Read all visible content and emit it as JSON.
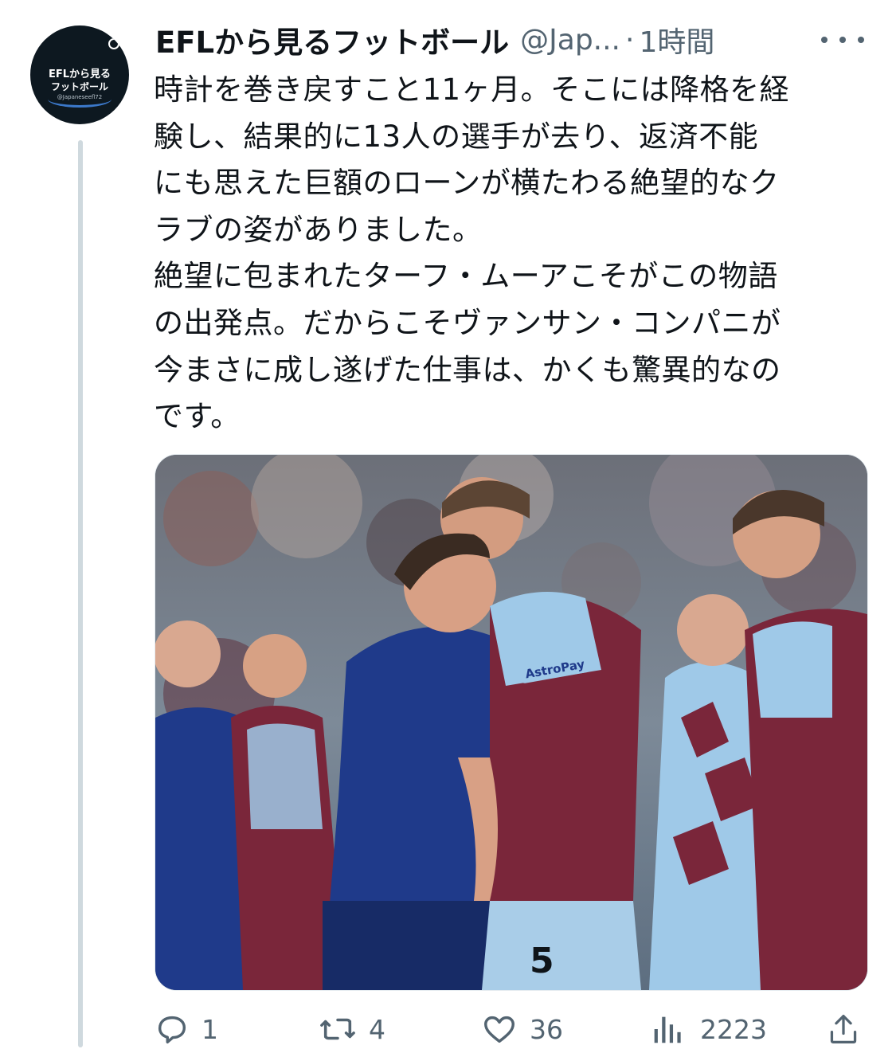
{
  "tweet": {
    "author": {
      "name": "EFLから見るフットボール",
      "handle": "@Jap...",
      "avatar_line1": "EFLから見る",
      "avatar_line2": "フットボール",
      "avatar_line3": "@Japaneseefl72"
    },
    "separator": "·",
    "time": "1時間",
    "text_lines": [
      "時計を巻き戻すこと11ヶ月。そこには降格を経",
      "験し、結果的に13人の選手が去り、返済不能",
      "にも思えた巨額のローンが横たわる絶望的なク",
      "ラブの姿がありました。",
      "絶望に包まれたターフ・ムーアこそがこの物語",
      "の出発点。だからこそヴァンサン・コンパニが",
      "今まさに成し遂げた仕事は、かくも驚異的なの",
      "です。"
    ],
    "media": {
      "jersey_sponsor": "AstroPay",
      "jersey_number": "5"
    },
    "actions": {
      "replies": "1",
      "retweets": "4",
      "likes": "36",
      "views": "2223"
    }
  },
  "colors": {
    "text": "#0f1419",
    "secondary": "#536471",
    "thread_line": "#cfd9de",
    "claret": "#7a263a",
    "sky_blue": "#9fc9e8",
    "navy": "#1f3a8a"
  },
  "icons": [
    "more-icon",
    "reply-icon",
    "retweet-icon",
    "like-icon",
    "views-icon",
    "share-icon"
  ]
}
